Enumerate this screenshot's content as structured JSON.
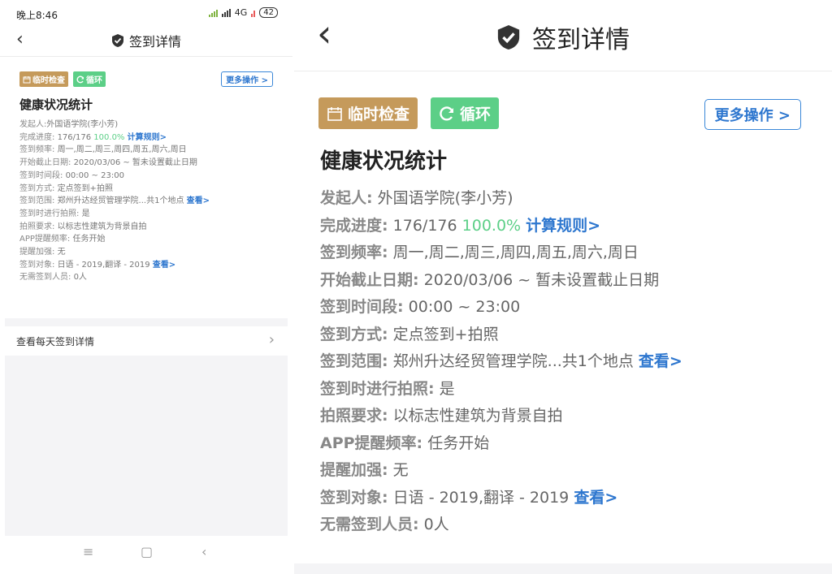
{
  "status": {
    "time": "晚上8:46",
    "network": "4G",
    "battery": "42"
  },
  "nav": {
    "title": "签到详情",
    "back_glyph": "‹"
  },
  "tags": {
    "temp_check": "临时检查",
    "loop": "循环"
  },
  "more_button": "更多操作 >",
  "heading": "健康状况统计",
  "info": {
    "initiator": {
      "label": "发起人:",
      "value": "外国语学院(李小芳)"
    },
    "progress": {
      "label": "完成进度:",
      "count": "176/176",
      "percent": "100.0%",
      "rule_link": "计算规则>"
    },
    "frequency": {
      "label": "签到频率:",
      "value": "周一,周二,周三,周四,周五,周六,周日"
    },
    "date_range": {
      "label": "开始截止日期:",
      "value": "2020/03/06 ~ 暂未设置截止日期"
    },
    "time_range": {
      "label": "签到时间段:",
      "value": "00:00 ~ 23:00"
    },
    "method": {
      "label": "签到方式:",
      "value": "定点签到+拍照"
    },
    "scope": {
      "label": "签到范围:",
      "value": "郑州升达经贸管理学院...共1个地点",
      "link": "查看>"
    },
    "photo_on_signin": {
      "label": "签到时进行拍照:",
      "value": "是"
    },
    "photo_requirement": {
      "label": "拍照要求:",
      "value": "以标志性建筑为背景自拍"
    },
    "app_reminder": {
      "label": "APP提醒频率:",
      "value": "任务开始"
    },
    "reminder_boost": {
      "label": "提醒加强:",
      "value": "无"
    },
    "targets": {
      "label": "签到对象:",
      "value": "日语 - 2019,翻译 - 2019",
      "link": "查看>"
    },
    "exempt": {
      "label": "无需签到人员:",
      "value": "0人"
    }
  },
  "daily_row": {
    "label": "查看每天签到详情",
    "chevron": "›"
  },
  "system_nav": {
    "menu": "≡",
    "home": "▢",
    "back": "‹"
  },
  "colors": {
    "gold": "#c59a5b",
    "green": "#5ccf87",
    "link_blue": "#2e77cf"
  }
}
